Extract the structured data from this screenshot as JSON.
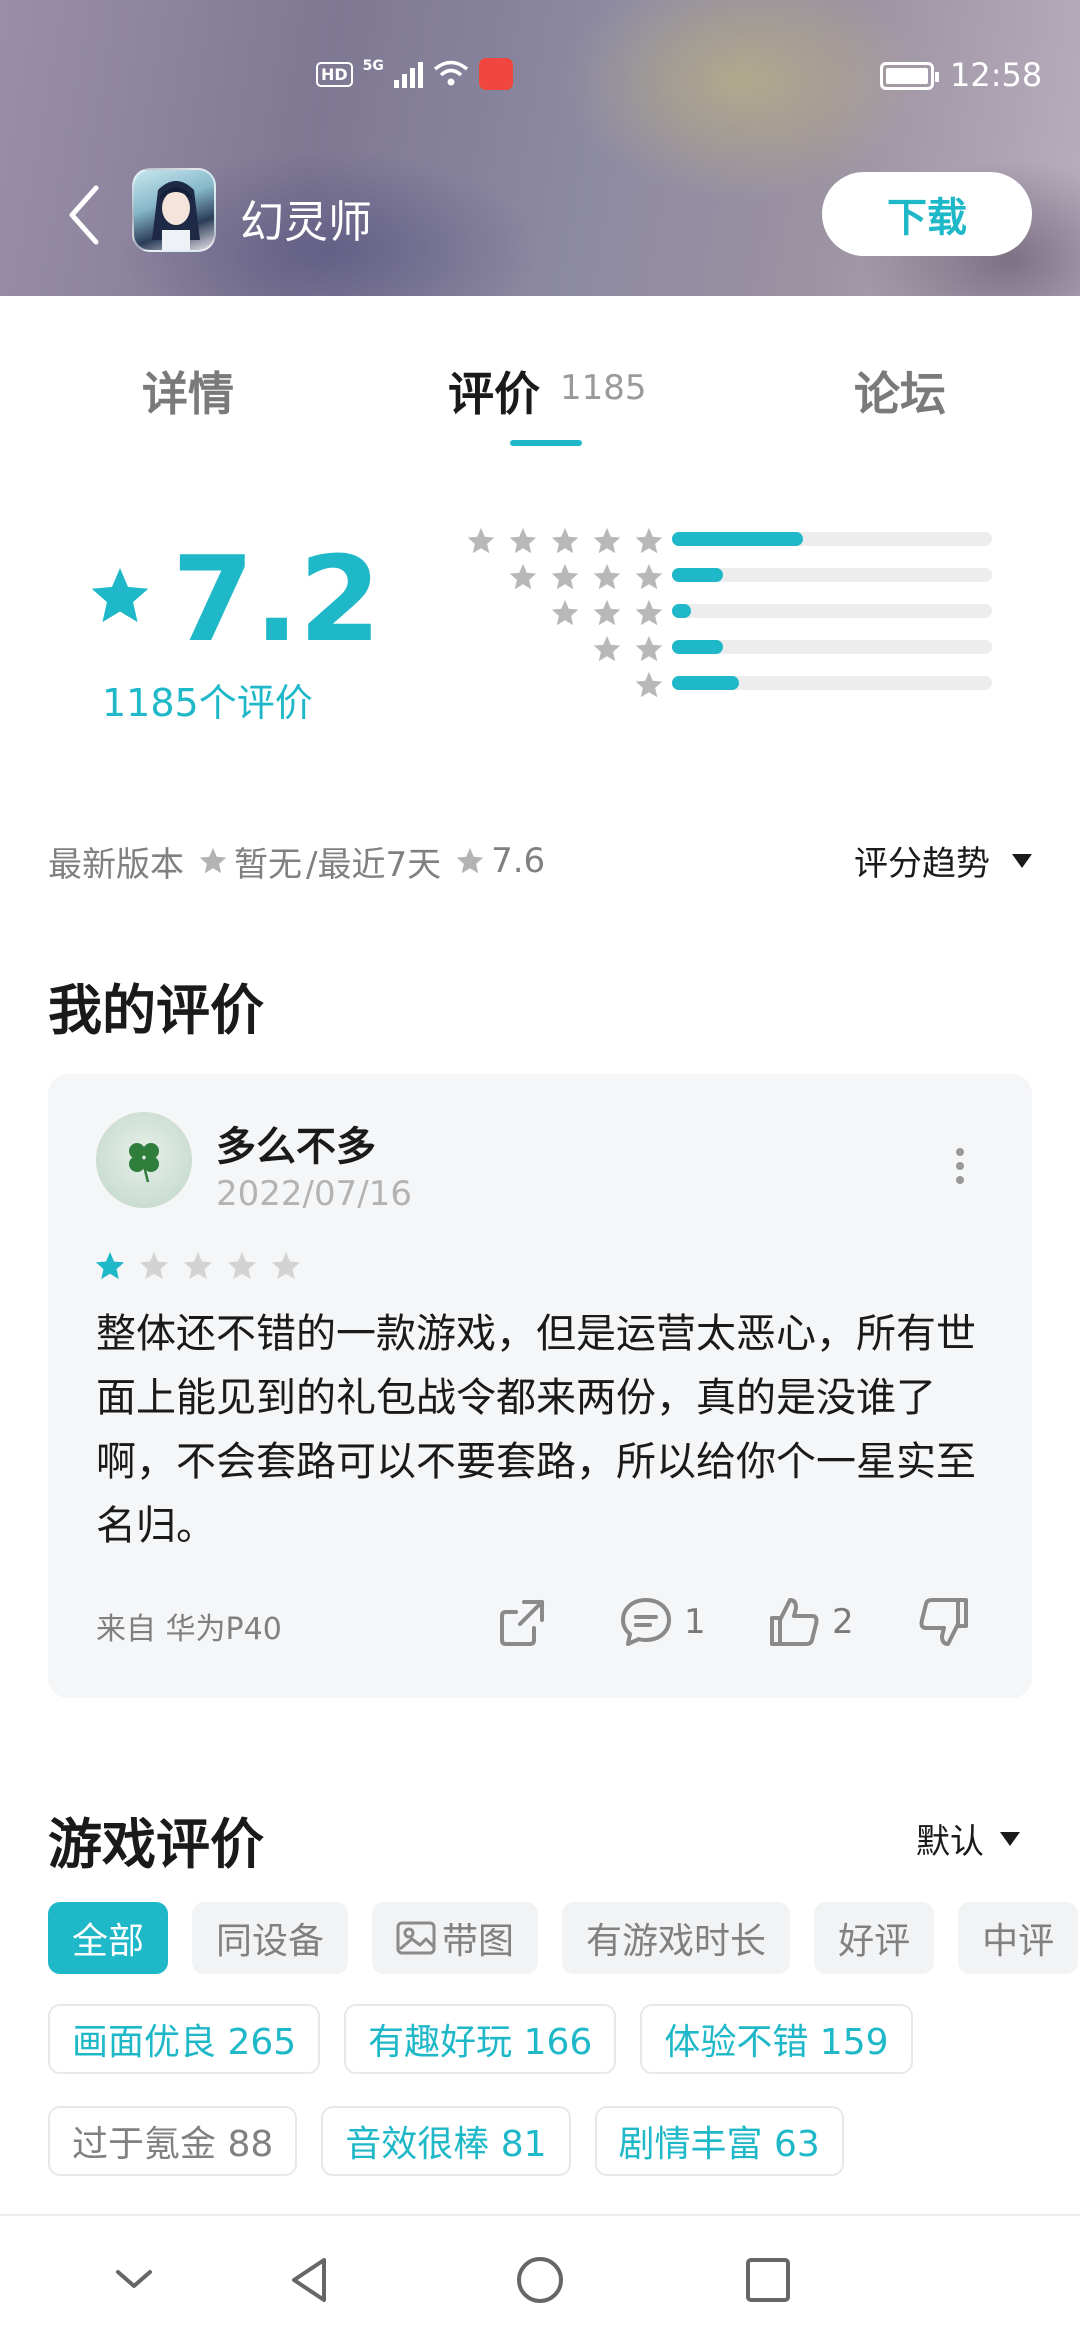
{
  "status_bar": {
    "time": "12:58",
    "hd_label": "HD",
    "network": "5G"
  },
  "header": {
    "app_name": "幻灵师",
    "download_label": "下载",
    "back_icon": "chevron-left-icon"
  },
  "tabs": [
    {
      "label": "详情"
    },
    {
      "label": "评价",
      "count": "1185"
    },
    {
      "label": "论坛"
    }
  ],
  "rating": {
    "score": "7.2",
    "count_text": "1185个评价",
    "distribution": [
      {
        "stars": 5,
        "fraction": 0.41
      },
      {
        "stars": 4,
        "fraction": 0.16
      },
      {
        "stars": 3,
        "fraction": 0.06
      },
      {
        "stars": 2,
        "fraction": 0.16
      },
      {
        "stars": 1,
        "fraction": 0.21
      }
    ]
  },
  "version": {
    "latest_label": "最新版本",
    "latest_value": "暂无",
    "recent_label": "/最近7天",
    "recent_value": "7.6",
    "trend_label": "评分趋势"
  },
  "my_review": {
    "heading": "我的评价",
    "reviewer": "多么不多",
    "date": "2022/07/16",
    "stars": 1,
    "text": "整体还不错的一款游戏，但是运营太恶心，所有世面上能见到的礼包战令都来两份，真的是没谁了啊，不会套路可以不要套路，所以给你个一星实至名归。",
    "device": "来自 华为P40",
    "comments": "1",
    "likes": "2"
  },
  "game_reviews": {
    "heading": "游戏评价",
    "sort_label": "默认",
    "filters": [
      "全部",
      "同设备",
      "带图",
      "有游戏时长",
      "好评",
      "中评"
    ],
    "tags_row1": [
      "画面优良 265",
      "有趣好玩 166",
      "体验不错 159"
    ],
    "tags_row2": [
      "过于氪金 88",
      "音效很棒 81",
      "剧情丰富 63"
    ]
  },
  "colors": {
    "accent": "#1fb8c8",
    "card_bg": "#f5f6f8",
    "chip_bg": "#f2f3f5"
  }
}
